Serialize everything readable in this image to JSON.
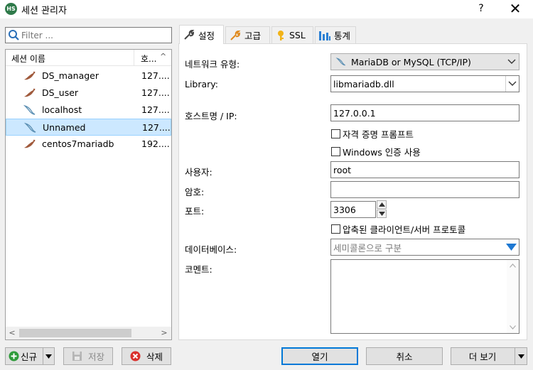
{
  "window": {
    "title": "세션 관리자",
    "help": "?",
    "close": "✕",
    "icon_text": "HS"
  },
  "filter": {
    "placeholder": "Filter ..."
  },
  "session_list": {
    "col_name": "세션 이름",
    "col_host": "호...",
    "sort_arrow": "^",
    "rows": [
      {
        "name": "DS_manager",
        "host": "127....",
        "icon": "mariadb-seal-icon",
        "selected": false
      },
      {
        "name": "DS_user",
        "host": "127....",
        "icon": "mariadb-seal-icon",
        "selected": false
      },
      {
        "name": "localhost",
        "host": "127....",
        "icon": "mysql-dolphin-icon",
        "selected": false
      },
      {
        "name": "Unnamed",
        "host": "127....",
        "icon": "mysql-dolphin-icon",
        "selected": true
      },
      {
        "name": "centos7mariadb",
        "host": "192....",
        "icon": "mariadb-seal-icon",
        "selected": false
      }
    ]
  },
  "tabs": [
    {
      "label": "설정",
      "icon": "wrench-icon",
      "active": true
    },
    {
      "label": "고급",
      "icon": "wrench-orange-icon",
      "active": false
    },
    {
      "label": "SSL",
      "icon": "key-icon",
      "active": false
    },
    {
      "label": "통계",
      "icon": "bar-chart-icon",
      "active": false
    }
  ],
  "settings": {
    "network_type_label": "네트워크 유형:",
    "network_type_value": "MariaDB or MySQL (TCP/IP)",
    "library_label": "Library:",
    "library_value": "libmariadb.dll",
    "host_label": "호스트명 / IP:",
    "host_value": "127.0.0.1",
    "prompt_cred_label": "자격 증명 프롬프트",
    "windows_auth_label": "Windows 인증 사용",
    "user_label": "사용자:",
    "user_value": "root",
    "password_label": "암호:",
    "password_value": "",
    "port_label": "포트:",
    "port_value": "3306",
    "compressed_label": "압축된 클라이언트/서버 프로토콜",
    "database_label": "데이터베이스:",
    "database_placeholder": "세미콜론으로 구분",
    "comment_label": "코멘트:",
    "comment_value": ""
  },
  "buttons": {
    "new": "신규",
    "save": "저장",
    "delete": "삭제",
    "open": "열기",
    "cancel": "취소",
    "more": "더 보기"
  },
  "colors": {
    "selection": "#cce8ff",
    "accent": "#0078d7",
    "new_green": "#2e9b3a",
    "delete_red": "#d9302c"
  }
}
